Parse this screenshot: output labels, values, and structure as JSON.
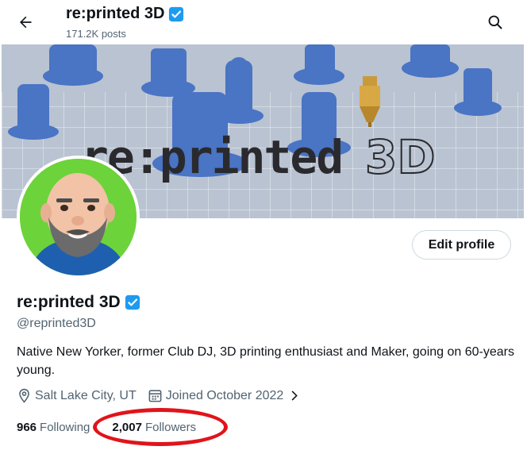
{
  "header": {
    "name": "re:printed 3D",
    "posts": "171.2K posts"
  },
  "banner": {
    "logo_text": "re:printed 3D"
  },
  "profile": {
    "name": "re:printed 3D",
    "handle": "@reprinted3D",
    "bio": "Native New Yorker, former Club DJ, 3D printing enthusiast and Maker, going on 60-years young.",
    "location": "Salt Lake City, UT",
    "joined": "Joined October 2022",
    "edit_label": "Edit profile"
  },
  "stats": {
    "following_count": "966",
    "following_label": "Following",
    "followers_count": "2,007",
    "followers_label": "Followers"
  },
  "colors": {
    "verified": "#1d9bf0",
    "annotation": "#e0141b",
    "avatar_bg": "#6dd33a"
  },
  "icons": {
    "back": "arrow-left-icon",
    "search": "search-icon",
    "verified": "verified-badge-icon",
    "location": "location-pin-icon",
    "calendar": "calendar-icon",
    "chevron": "chevron-right-icon"
  }
}
